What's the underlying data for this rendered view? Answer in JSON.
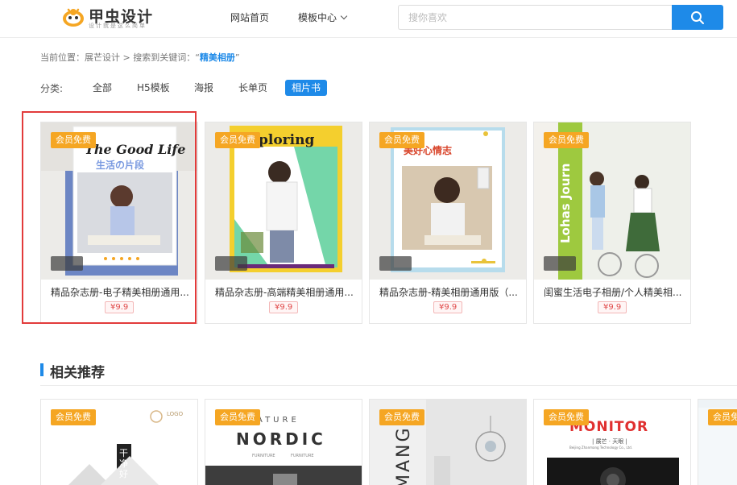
{
  "header": {
    "logo_text": "甲虫设计",
    "logo_slogan": "设计就是这么简单",
    "nav_home": "网站首页",
    "nav_templates": "模板中心",
    "search_placeholder": "搜你喜欢"
  },
  "breadcrumb": {
    "prefix": "当前位置：展芒设计 > 搜索到关键词：“",
    "keyword": "精美相册",
    "suffix": "”"
  },
  "category": {
    "label": "分类:",
    "items": [
      "全部",
      "H5模板",
      "海报",
      "长单页",
      "相片书"
    ],
    "active": "相片书"
  },
  "cards": [
    {
      "badge": "会员免费",
      "title": "精品杂志册-电子精美相册通用...",
      "price": "¥9.9",
      "cover_text": "The Good Life",
      "cover_sub": "生活の片段"
    },
    {
      "badge": "会员免费",
      "title": "精品杂志册-高端精美相册通用...",
      "price": "¥9.9",
      "cover_text": "ploring"
    },
    {
      "badge": "会员免费",
      "title": "精品杂志册-精美相册通用版（...",
      "price": "¥9.9",
      "cover_text": "美好心情志"
    },
    {
      "badge": "会员免费",
      "title": "闺蜜生活电子相册/个人精美相...",
      "price": "¥9.9",
      "cover_text": "Lohas Journ"
    }
  ],
  "section": {
    "title": "相关推荐"
  },
  "recommend": [
    {
      "badge": "会员免费",
      "logo": "LOGO",
      "vertical": "干净好"
    },
    {
      "badge": "会员免费",
      "top": "ATURE",
      "title": "NORDIC",
      "sub1": "FURNITURE",
      "sub2": "FURNITURE"
    },
    {
      "badge": "会员免费",
      "vertical": "MANG"
    },
    {
      "badge": "会员免费",
      "title": "MONITOR",
      "sub": "| 展芒 · 天眼 |",
      "sub2": "Beijing Zhanmang Technology Co., Ltd."
    },
    {
      "badge": "会员免费"
    }
  ],
  "colors": {
    "accent": "#1e8ae8",
    "badge": "#f5a623",
    "price": "#e04848",
    "highlight": "#e23b3b"
  }
}
